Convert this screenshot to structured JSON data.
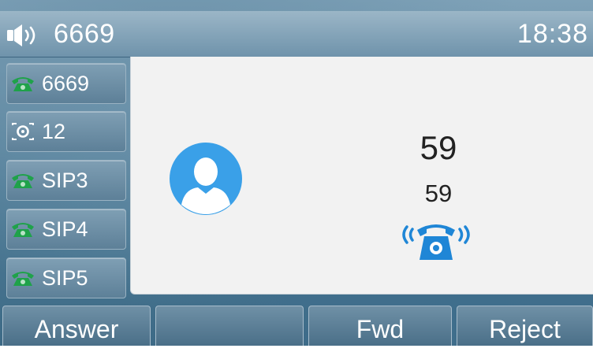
{
  "status_bar": {
    "line": "6669",
    "time": "18:38",
    "icon": "speaker-volume-icon"
  },
  "line_keys": [
    {
      "label": "6669",
      "icon": "phone-handset-icon"
    },
    {
      "label": "12",
      "icon": "focus-target-icon"
    },
    {
      "label": "SIP3",
      "icon": "phone-handset-icon"
    },
    {
      "label": "SIP4",
      "icon": "phone-handset-icon"
    },
    {
      "label": "SIP5",
      "icon": "phone-handset-icon"
    }
  ],
  "incoming_call": {
    "name": "59",
    "number": "59",
    "avatar_icon": "contact-avatar-icon",
    "status_icon": "ringing-phone-icon"
  },
  "soft_keys": [
    "Answer",
    "",
    "Fwd",
    "Reject"
  ],
  "colors": {
    "handset_green": "#1fa24a",
    "ring_blue": "#1f86d6",
    "avatar_blue": "#3aa0e8",
    "panel_bg": "#f2f2f2"
  }
}
